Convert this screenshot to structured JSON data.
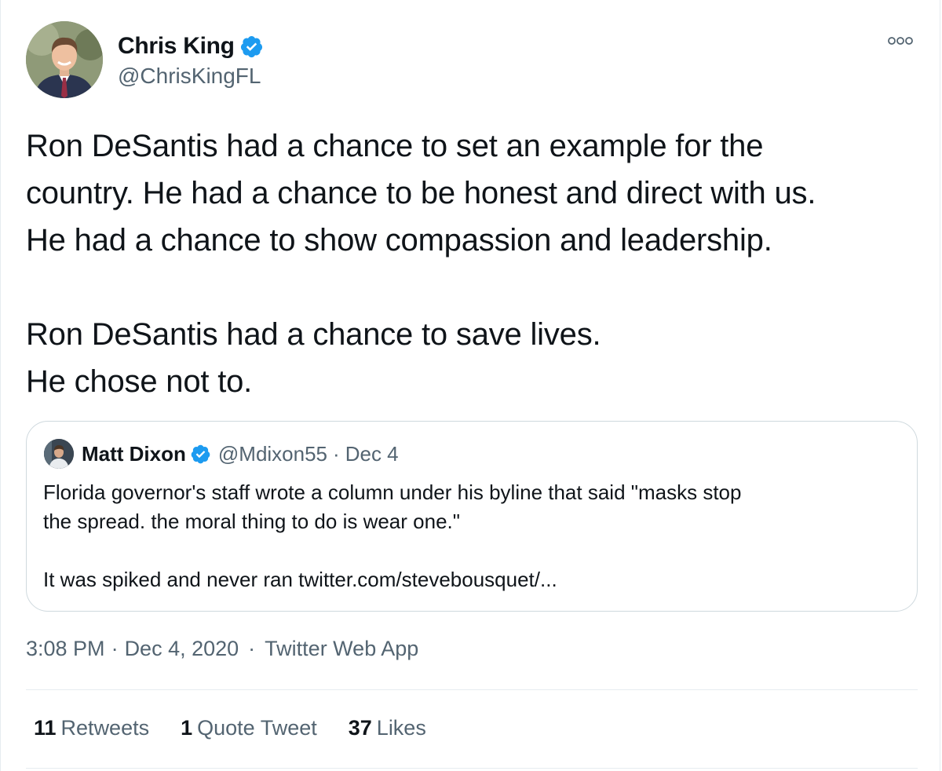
{
  "author": {
    "name": "Chris King",
    "handle": "@ChrisKingFL",
    "avatar": "profile-photo"
  },
  "tweet": {
    "lines": [
      "Ron DeSantis had a chance to set an example for the",
      "country. He had a chance to be honest and direct with us.",
      "He had a chance to show compassion and leadership.",
      "",
      "Ron DeSantis had a chance to save lives.",
      "He chose not to."
    ]
  },
  "quoted": {
    "name": "Matt Dixon",
    "handle": "@Mdixon55",
    "separator": "·",
    "date": "Dec 4",
    "lines": [
      "Florida governor's staff wrote a column under his byline that said \"masks stop",
      "the spread. the moral thing to do is wear one.\"",
      "",
      "It was spiked and never ran twitter.com/stevebousquet/..."
    ]
  },
  "meta": {
    "time": "3:08 PM",
    "sep1": "·",
    "date": "Dec 4, 2020",
    "sep2": "·",
    "source": "Twitter Web App"
  },
  "stats": {
    "retweets": {
      "count": "11",
      "label": "Retweets"
    },
    "quotes": {
      "count": "1",
      "label": "Quote Tweet"
    },
    "likes": {
      "count": "37",
      "label": "Likes"
    }
  },
  "colors": {
    "verified": "#1d9bf0",
    "secondary_text": "#536471",
    "primary_text": "#0f1419",
    "border": "#cfd9de"
  },
  "icons": {
    "verified": "verified-badge-icon",
    "more": "more-options-icon"
  }
}
